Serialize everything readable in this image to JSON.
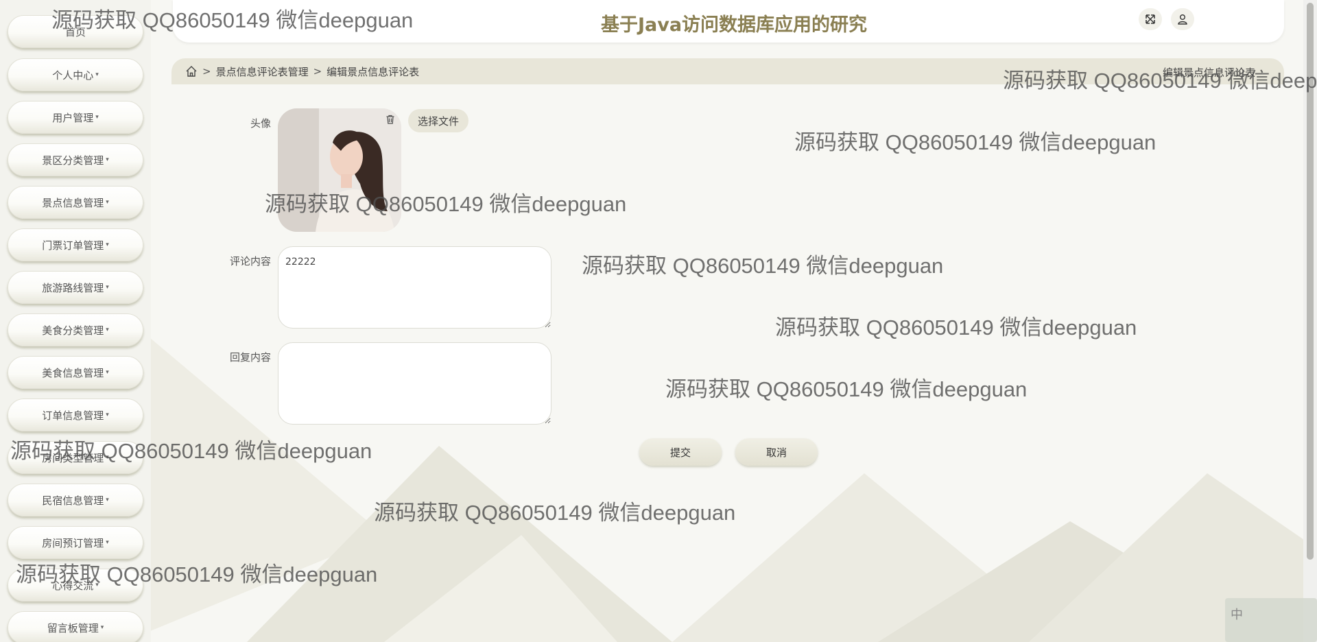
{
  "header": {
    "title": "基于Java访问数据库应用的研究"
  },
  "sidebar": {
    "items": [
      {
        "label": "首页",
        "caret": ""
      },
      {
        "label": "个人中心",
        "caret": "▾"
      },
      {
        "label": "用户管理",
        "caret": "▾"
      },
      {
        "label": "景区分类管理",
        "caret": "▾"
      },
      {
        "label": "景点信息管理",
        "caret": "▾"
      },
      {
        "label": "门票订单管理",
        "caret": "▾"
      },
      {
        "label": "旅游路线管理",
        "caret": "▾"
      },
      {
        "label": "美食分类管理",
        "caret": "▾"
      },
      {
        "label": "美食信息管理",
        "caret": "▾"
      },
      {
        "label": "订单信息管理",
        "caret": "▾"
      },
      {
        "label": "房间类型管理",
        "caret": "▾"
      },
      {
        "label": "民宿信息管理",
        "caret": "▾"
      },
      {
        "label": "房间预订管理",
        "caret": "▾"
      },
      {
        "label": "心得交流",
        "caret": "▾"
      },
      {
        "label": "留言板管理",
        "caret": "▾"
      }
    ]
  },
  "breadcrumb": {
    "sep": ">",
    "item1": "景点信息评论表管理",
    "item2": "编辑景点信息评论表",
    "right": "编辑景点信息评论表"
  },
  "form": {
    "avatar_label": "头像",
    "file_button": "选择文件",
    "comment_label": "评论内容",
    "comment_value": "22222",
    "reply_label": "回复内容",
    "reply_value": "",
    "submit": "提交",
    "cancel": "取消"
  },
  "ime": {
    "char": "中"
  },
  "watermark": {
    "text": "源码获取 QQ86050149 微信deepguan"
  },
  "icons": {
    "home": "home-icon",
    "expand": "fullscreen-icon",
    "user": "user-icon",
    "trash": "trash-icon"
  }
}
